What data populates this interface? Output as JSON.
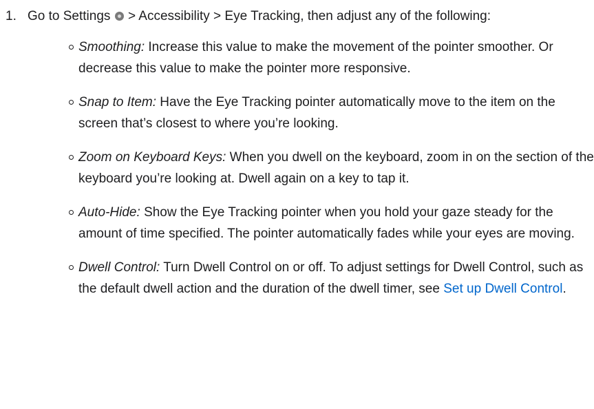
{
  "step": {
    "number": "1.",
    "text_before_icon": "Go to Settings",
    "icon": "settings-gear-icon",
    "text_after_icon": "> Accessibility > Eye Tracking, then adjust any of the following:"
  },
  "options": [
    {
      "term": "Smoothing:",
      "text": "Increase this value to make the movement of the pointer smoother. Or decrease this value to make the pointer more responsive."
    },
    {
      "term": "Snap to Item:",
      "text": "Have the Eye Tracking pointer automatically move to the item on the screen that’s closest to where you’re looking."
    },
    {
      "term": "Zoom on Keyboard Keys:",
      "text": "When you dwell on the keyboard, zoom in on the section of the keyboard you’re looking at. Dwell again on a key to tap it."
    },
    {
      "term": "Auto-Hide:",
      "text": "Show the Eye Tracking pointer when you hold your gaze steady for the amount of time specified. The pointer automatically fades while your eyes are moving."
    },
    {
      "term": "Dwell Control:",
      "text": "Turn Dwell Control on or off. To adjust settings for Dwell Control, such as the default dwell action and the duration of the dwell timer, see",
      "link": "Set up Dwell Control",
      "after_link": "."
    }
  ],
  "colors": {
    "text": "#1d1d1f",
    "link": "#0066cc"
  }
}
